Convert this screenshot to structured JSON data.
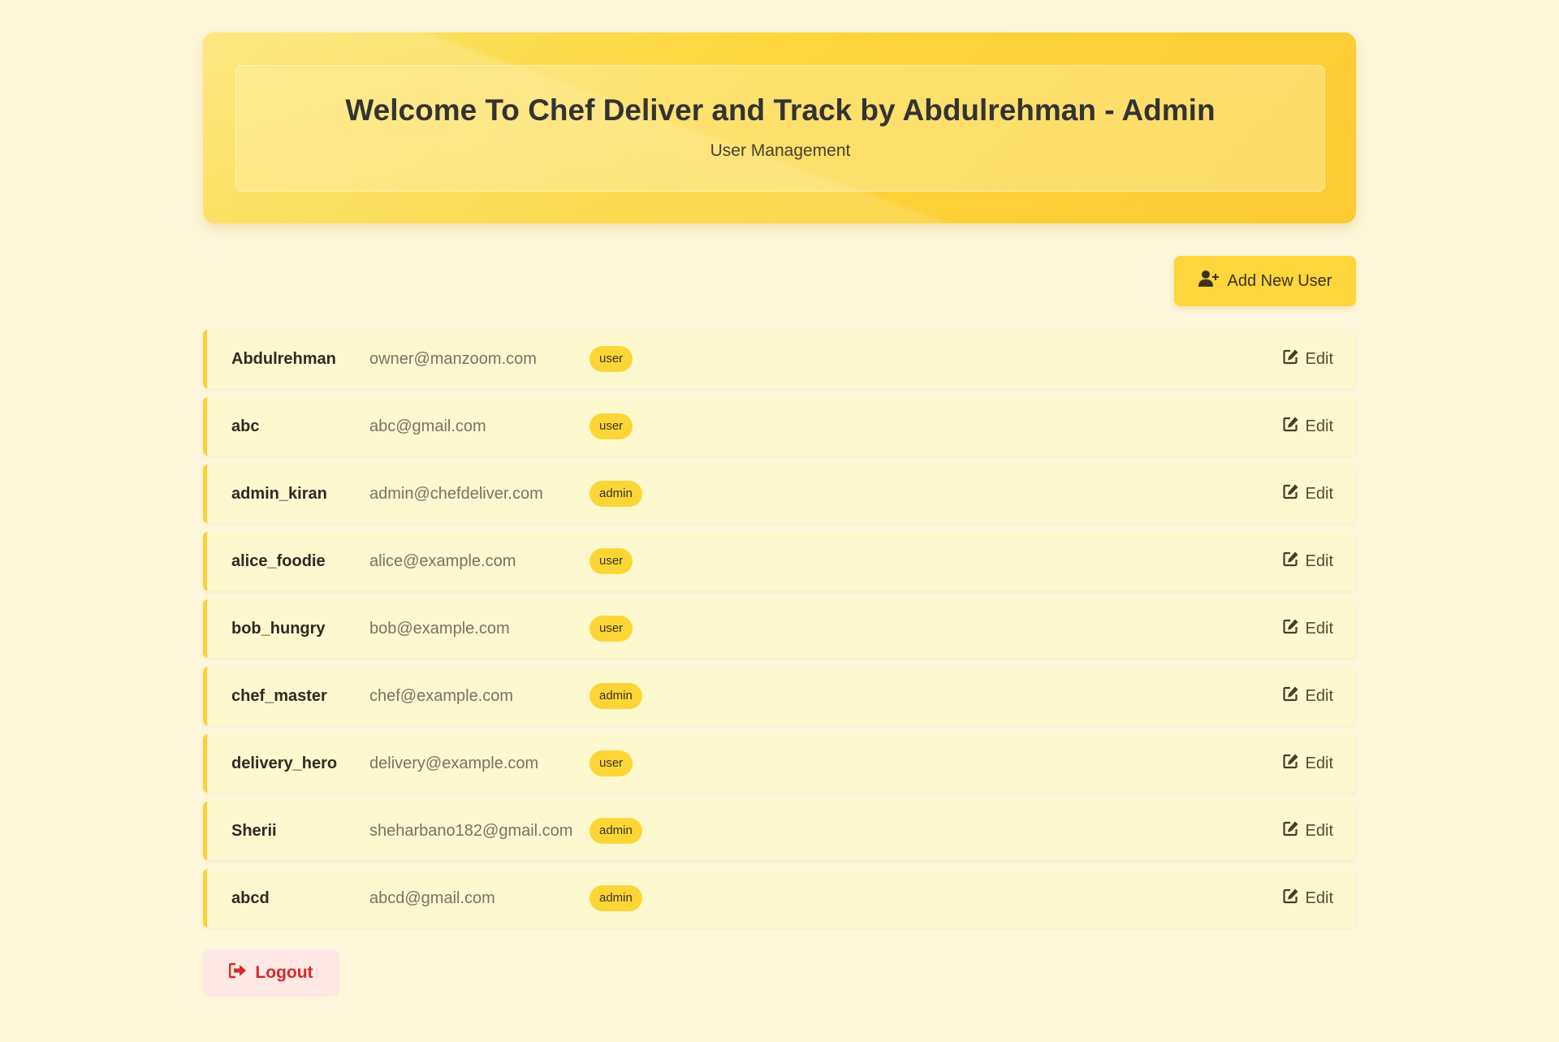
{
  "header": {
    "title": "Welcome To Chef Deliver and Track by Abdulrehman - Admin",
    "subtitle": "User Management"
  },
  "toolbar": {
    "add_label": "Add New User",
    "add_icon": "user-plus-icon"
  },
  "users": [
    {
      "name": "Abdulrehman",
      "email": "owner@manzoom.com",
      "role": "user",
      "edit": "Edit"
    },
    {
      "name": "abc",
      "email": "abc@gmail.com",
      "role": "user",
      "edit": "Edit"
    },
    {
      "name": "admin_kiran",
      "email": "admin@chefdeliver.com",
      "role": "admin",
      "edit": "Edit"
    },
    {
      "name": "alice_foodie",
      "email": "alice@example.com",
      "role": "user",
      "edit": "Edit"
    },
    {
      "name": "bob_hungry",
      "email": "bob@example.com",
      "role": "user",
      "edit": "Edit"
    },
    {
      "name": "chef_master",
      "email": "chef@example.com",
      "role": "admin",
      "edit": "Edit"
    },
    {
      "name": "delivery_hero",
      "email": "delivery@example.com",
      "role": "user",
      "edit": "Edit"
    },
    {
      "name": "Sherii",
      "email": "sheharbano182@gmail.com",
      "role": "admin",
      "edit": "Edit"
    },
    {
      "name": "abcd",
      "email": "abcd@gmail.com",
      "role": "admin",
      "edit": "Edit"
    }
  ],
  "footer": {
    "logout_label": "Logout",
    "logout_icon": "sign-out-icon"
  },
  "colors": {
    "background": "#fef7dc",
    "accent": "#fcd63a",
    "row_bg": "#fef8cf",
    "logout_text": "#d62a2a",
    "logout_bg": "#fde8e4"
  }
}
